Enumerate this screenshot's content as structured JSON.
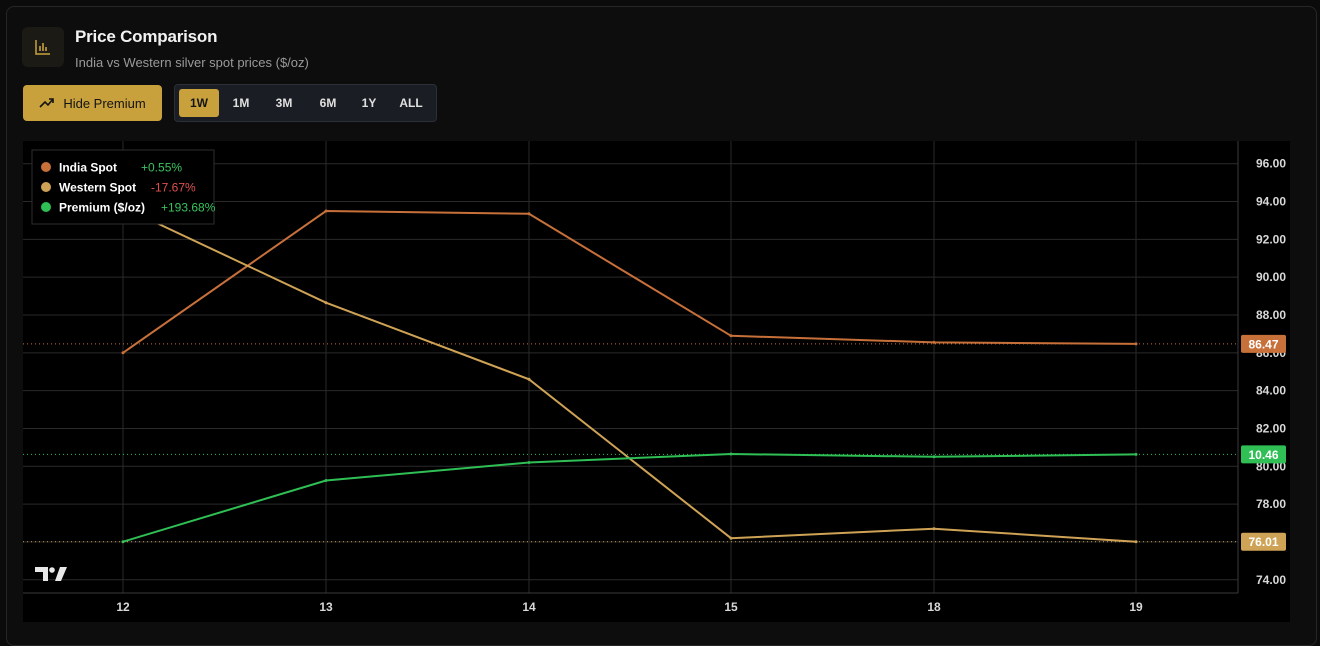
{
  "header": {
    "title": "Price Comparison",
    "subtitle": "India vs Western silver spot prices ($/oz)",
    "icon": "bar-chart-icon"
  },
  "controls": {
    "premium_button_label": "Hide Premium",
    "premium_button_icon": "trend-up-icon",
    "ranges": [
      "1W",
      "1M",
      "3M",
      "6M",
      "1Y",
      "ALL"
    ],
    "active_range": "1W"
  },
  "colors": {
    "india": "#c8703a",
    "western": "#cfa356",
    "premium": "#2fbf55",
    "accent": "#c9a13c"
  },
  "chart_data": {
    "type": "line",
    "x": [
      "12",
      "13",
      "14",
      "15",
      "18",
      "19"
    ],
    "ylim": [
      73.3,
      97.2
    ],
    "yticks": [
      "96.00",
      "94.00",
      "92.00",
      "90.00",
      "88.00",
      "86.00",
      "84.00",
      "82.00",
      "80.00",
      "78.00",
      "76.00",
      "74.00"
    ],
    "series": [
      {
        "name": "India Spot",
        "change": "+0.55%",
        "values": [
          86.0,
          93.5,
          93.35,
          86.9,
          86.55,
          86.47
        ]
      },
      {
        "name": "Western Spot",
        "change": "-17.67%",
        "values": [
          93.7,
          88.65,
          84.6,
          76.2,
          76.7,
          76.01
        ]
      },
      {
        "name": "Premium ($/oz)",
        "change": "+193.68%",
        "values": [
          76.01,
          79.25,
          80.2,
          80.65,
          80.5,
          80.63
        ]
      }
    ],
    "last_value_labels": [
      "86.47",
      "10.46",
      "76.01"
    ],
    "grid": true,
    "legend": "top-left"
  }
}
